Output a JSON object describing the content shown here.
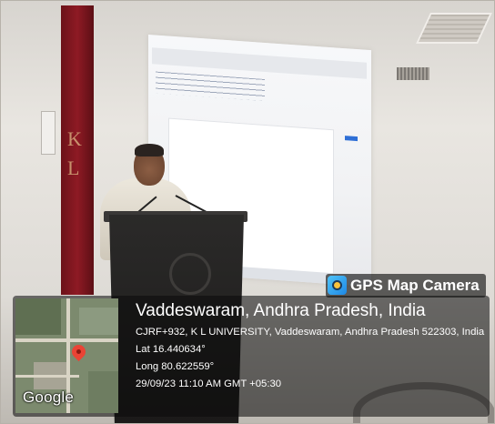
{
  "stamp": {
    "app_name": "GPS Map Camera",
    "location_title": "Vaddeswaram, Andhra Pradesh, India",
    "address": "CJRF+932, K L UNIVERSITY, Vaddeswaram, Andhra Pradesh 522303, India",
    "latitude": "Lat 16.440634°",
    "longitude": "Long 80.622559°",
    "datetime": "29/09/23 11:10 AM GMT +05:30"
  },
  "map": {
    "provider_logo": "Google"
  },
  "banner": {
    "letters": [
      "K",
      "L"
    ]
  },
  "colors": {
    "banner": "#8e1a24",
    "overlay": "#0a0a0a",
    "map_pin": "#ea4335",
    "app_icon": "#1e88e5"
  },
  "icons": [
    "gps-map-camera-app-icon",
    "map-pin-icon"
  ]
}
